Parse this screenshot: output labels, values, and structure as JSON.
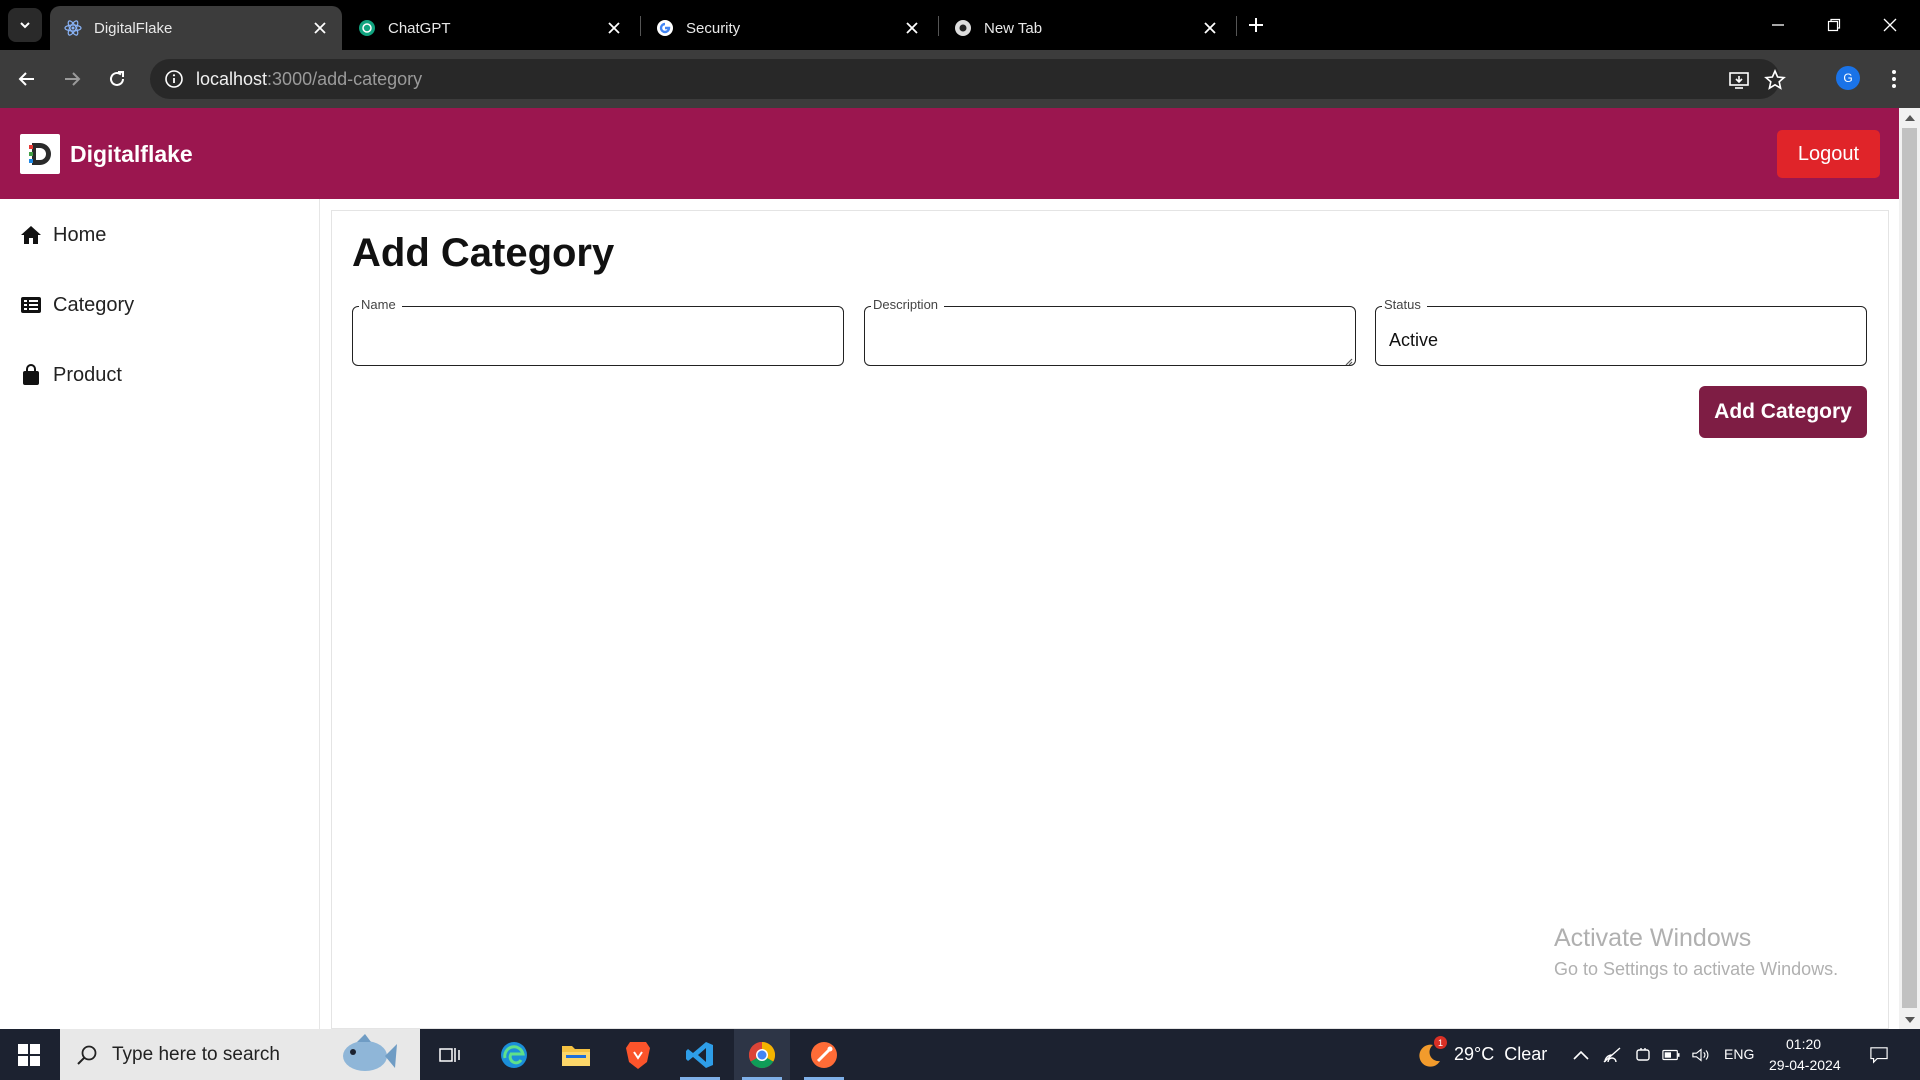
{
  "browser": {
    "tabs": [
      {
        "title": "DigitalFlake",
        "icon": "react-icon",
        "active": true
      },
      {
        "title": "ChatGPT",
        "icon": "chatgpt-icon",
        "active": false
      },
      {
        "title": "Security",
        "icon": "google-icon",
        "active": false
      },
      {
        "title": "New Tab",
        "icon": "chrome-icon",
        "active": false
      }
    ],
    "url_host": "localhost",
    "url_path": ":3000/add-category",
    "profile_initial": "G"
  },
  "header": {
    "brand": "Digitalflake",
    "logout_label": "Logout",
    "color": "#9b164f"
  },
  "sidebar": {
    "items": [
      {
        "label": "Home",
        "icon": "home-icon"
      },
      {
        "label": "Category",
        "icon": "list-icon"
      },
      {
        "label": "Product",
        "icon": "shopping-bag-icon"
      }
    ]
  },
  "main": {
    "title": "Add Category",
    "fields": {
      "name": {
        "label": "Name",
        "value": ""
      },
      "description": {
        "label": "Description",
        "value": ""
      },
      "status": {
        "label": "Status",
        "value": "Active"
      }
    },
    "submit_label": "Add Category",
    "submit_color": "#7e1d44"
  },
  "watermark": {
    "line1": "Activate Windows",
    "line2": "Go to Settings to activate Windows."
  },
  "taskbar": {
    "search_placeholder": "Type here to search",
    "weather": "29°C  Clear",
    "weather_badge": "1",
    "language": "ENG",
    "time": "01:20",
    "date": "29-04-2024"
  }
}
